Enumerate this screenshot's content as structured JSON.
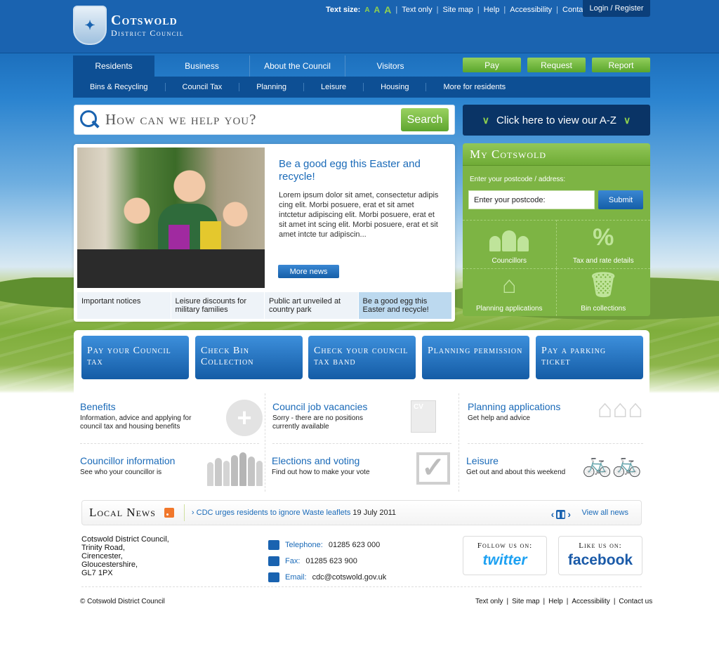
{
  "header": {
    "logo_line1": "Cotswold",
    "logo_line2": "District Council",
    "text_size_label": "Text size:",
    "text_size_options": [
      "A",
      "A",
      "A"
    ],
    "links": [
      "Text only",
      "Site map",
      "Help",
      "Accessibility",
      "Contact us"
    ],
    "login": "Login / Register"
  },
  "main_nav": [
    "Residents",
    "Business",
    "About the Council",
    "Visitors"
  ],
  "action_buttons": [
    "Pay",
    "Request",
    "Report"
  ],
  "sub_nav": [
    "Bins & Recycling",
    "Council Tax",
    "Planning",
    "Leisure",
    "Housing",
    "More for residents"
  ],
  "search": {
    "placeholder": "How can we help you?",
    "button": "Search"
  },
  "az": {
    "label": "Click here to view our A-Z"
  },
  "feature": {
    "title": "Be a good egg this Easter and recycle!",
    "body": "Lorem ipsum dolor sit amet, consectetur adipis cing elit. Morbi posuere, erat et  sit amet intctetur adipiscing elit. Morbi posuere, erat et  sit amet int scing elit. Morbi posuere, erat et  sit amet intcte tur adipiscin...",
    "more_button": "More news",
    "tabs": [
      "Important notices",
      "Leisure discounts for military families",
      "Public art unveiled at country park",
      "Be a good egg this Easter and recycle!"
    ]
  },
  "my_cotswold": {
    "title": "My Cotswold",
    "postcode_label": "Enter your postcode / address:",
    "postcode_value": "Enter your postcode:",
    "submit": "Submit",
    "tiles": [
      "Councillors",
      "Tax and rate details",
      "Planning applications",
      "Bin collections"
    ]
  },
  "quick_buttons": [
    "Pay your Council tax",
    "Check Bin Collection",
    "Check your council tax band",
    "Planning permission",
    "Pay a parking ticket"
  ],
  "link_blocks": [
    {
      "title": "Benefits",
      "desc": "Information, advice and applying for council tax and housing benefits"
    },
    {
      "title": "Council job vacancies",
      "desc": "Sorry - there are no positions currently available",
      "icon_text": "CV"
    },
    {
      "title": "Planning applications",
      "desc": "Get help and advice"
    },
    {
      "title": "Councillor information",
      "desc": "See who your councillor is"
    },
    {
      "title": "Elections and voting",
      "desc": "Find out how to make your vote"
    },
    {
      "title": "Leisure",
      "desc": "Get out and about this weekend"
    }
  ],
  "local_news": {
    "title": "Local News",
    "headline": "CDC urges residents to ignore Waste leaflets",
    "date": "19 July 2011",
    "view_all": "View all news"
  },
  "footer": {
    "address": [
      "Cotswold District Council,",
      "Trinity Road,",
      "Cirencester,",
      "Gloucestershire,",
      "GL7 1PX"
    ],
    "telephone_label": "Telephone:",
    "telephone": "01285 623 000",
    "fax_label": "Fax:",
    "fax": "01285 623 900",
    "email_label": "Email:",
    "email": "cdc@cotswold.gov.uk",
    "twitter_label": "Follow us on:",
    "twitter": "twitter",
    "facebook_label": "Like us on:",
    "facebook": "facebook",
    "copyright": "© Cotswold District Council",
    "links": [
      "Text only",
      "Site map",
      "Help",
      "Accessibility",
      "Contact us"
    ]
  },
  "colors": {
    "primary_blue": "#1a63b0",
    "dark_navy": "#0a3466",
    "accent_green": "#7db444"
  }
}
